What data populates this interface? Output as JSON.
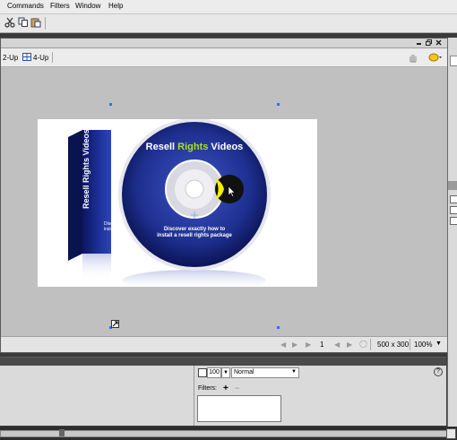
{
  "menu": {
    "items": [
      "Commands",
      "Filters",
      "Window",
      "Help"
    ]
  },
  "toolbar": {
    "icons": [
      "cut-icon",
      "copy-icon",
      "paste-icon"
    ]
  },
  "docbar": {
    "view_2up": "2-Up",
    "view_4up": "4-Up"
  },
  "artwork": {
    "disc_title_part1": "Resell ",
    "disc_title_part2": "Rights",
    "disc_title_part3": " Videos",
    "disc_caption_line1": "Discover exactly how to",
    "disc_caption_line2": "install a resell rights package",
    "box_title": "Resell Rights Videos",
    "box_caption_line1": "Discov",
    "box_caption_line2": "insta"
  },
  "status": {
    "page": "1",
    "canvas_size": "500 x 300",
    "zoom": "100%"
  },
  "properties": {
    "opacity_value": "100",
    "blend_mode": "Normal",
    "filters_label": "Filters:",
    "add_filter": "+",
    "remove_filter": "−"
  },
  "colors": {
    "disc_blue": "#1e2f8f",
    "accent_yellow": "#f4f000",
    "title_green": "#a8e01c"
  }
}
